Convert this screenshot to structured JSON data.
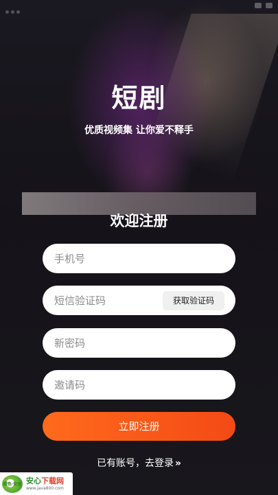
{
  "app": {
    "title": "短剧",
    "slogan": "优质视频集 让你爱不释手"
  },
  "form": {
    "heading": "欢迎注册",
    "phone_placeholder": "手机号",
    "code_placeholder": "短信验证码",
    "get_code_label": "获取验证码",
    "password_placeholder": "新密码",
    "invite_placeholder": "邀请码",
    "submit_label": "立即注册"
  },
  "footer": {
    "login_text": "已有账号，去登录",
    "login_chevron": "»"
  },
  "watermark": {
    "logo_text": "绿色·安全",
    "name_green": "安心",
    "name_red": "下载网",
    "url": "www.java800.com"
  },
  "colors": {
    "accent_start": "#ff6a1c",
    "accent_end": "#f44a16",
    "background": "#17151d"
  }
}
